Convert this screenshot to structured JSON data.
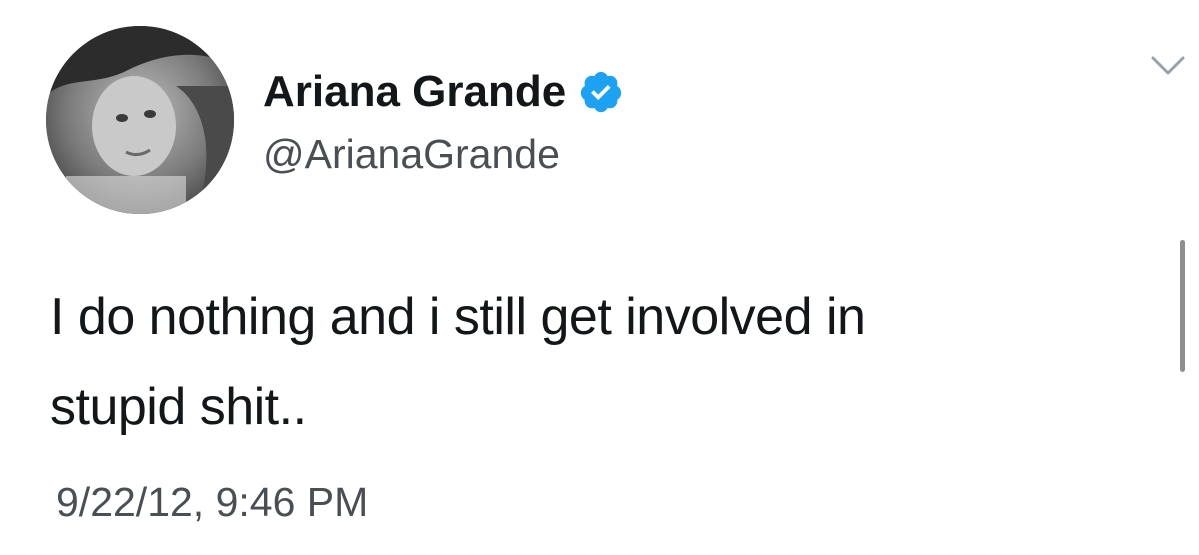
{
  "tweet": {
    "author": {
      "display_name": "Ariana Grande",
      "handle": "@ArianaGrande",
      "verified": true,
      "verified_icon": "verified-badge-icon",
      "verified_color": "#1da1f2",
      "avatar_style": "grayscale"
    },
    "text": "I do nothing and i still get involved in\nstupid shit..",
    "timestamp": "9/22/12, 9:46 PM",
    "menu_icon": "chevron-down-icon"
  }
}
